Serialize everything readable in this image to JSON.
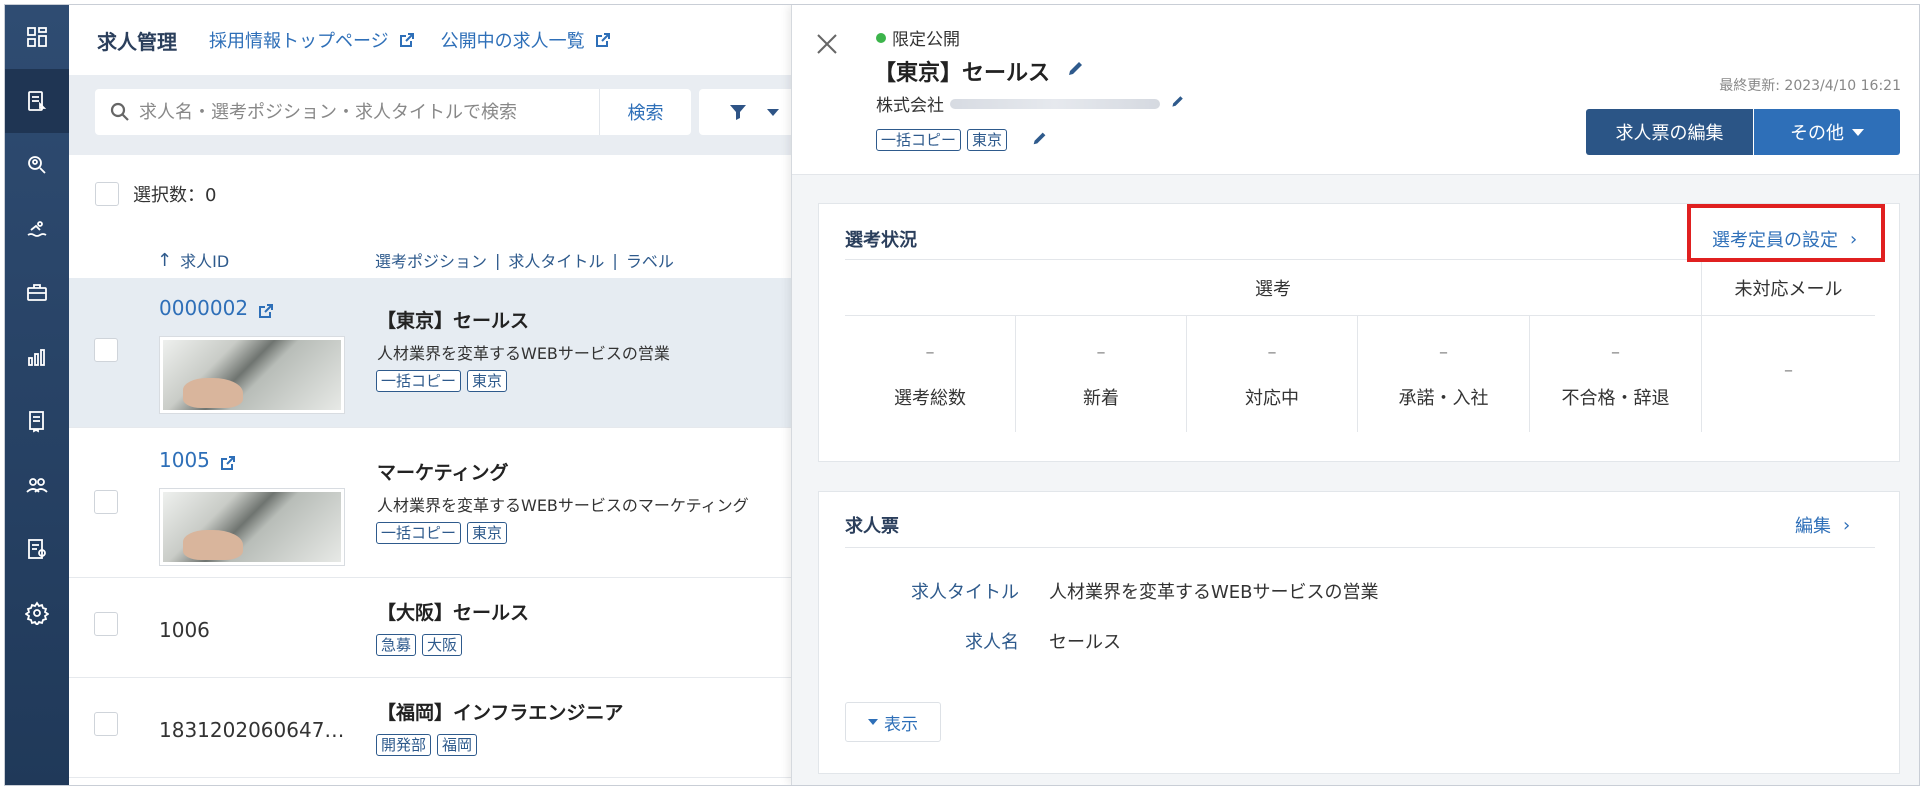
{
  "sidebar": {
    "icons": [
      "dashboard-icon",
      "job-list-icon",
      "candidate-search-icon",
      "swim-icon",
      "briefcase-icon",
      "bar-chart-icon",
      "document-icon",
      "users-icon",
      "report-icon",
      "settings-icon"
    ]
  },
  "list": {
    "title": "求人管理",
    "links": [
      "採用情報トップページ",
      "公開中の求人一覧"
    ],
    "search": {
      "placeholder": "求人名・選考ポジション・求人タイトルで検索",
      "button": "検索"
    },
    "selection": "選択数：0",
    "columns": {
      "id": "求人ID",
      "position": "選考ポジション",
      "job_title": "求人タイトル",
      "label": "ラベル"
    },
    "rows": [
      {
        "id": "0000002",
        "title": "【東京】セールス",
        "subtitle": "人材業界を変革するWEBサービスの営業",
        "tags": [
          "一括コピー",
          "東京"
        ]
      },
      {
        "id": "1005",
        "title": "マーケティング",
        "subtitle": "人材業界を変革するWEBサービスのマーケティング",
        "tags": [
          "一括コピー",
          "東京"
        ]
      },
      {
        "id": "1006",
        "title": "【大阪】セールス",
        "subtitle": "",
        "tags": [
          "急募",
          "大阪"
        ]
      },
      {
        "id": "1831202060647…",
        "title": "【福岡】インフラエンジニア",
        "subtitle": "",
        "tags": [
          "開発部",
          "福岡"
        ]
      }
    ]
  },
  "detail": {
    "status": "限定公開",
    "title": "【東京】セールス",
    "company": "株式会社",
    "tags": [
      "一括コピー",
      "東京"
    ],
    "updated": "最終更新: 2023/4/10 16:21",
    "edit_button": "求人票の編集",
    "other_button": "その他",
    "selection_card": {
      "title": "選考状況",
      "link": "選考定員の設定",
      "group_header": "選考",
      "mail_header": "未対応メール",
      "cells": [
        {
          "value": "–",
          "label": "選考総数"
        },
        {
          "value": "–",
          "label": "新着"
        },
        {
          "value": "–",
          "label": "対応中"
        },
        {
          "value": "–",
          "label": "承諾・入社"
        },
        {
          "value": "–",
          "label": "不合格・辞退"
        }
      ],
      "mail_value": "–"
    },
    "job_card": {
      "title": "求人票",
      "link": "編集",
      "fields": [
        {
          "label": "求人タイトル",
          "value": "人材業界を変革するWEBサービスの営業"
        },
        {
          "label": "求人名",
          "value": "セールス"
        }
      ],
      "show_button": "表示"
    }
  },
  "colors": {
    "sidebar": "#2f4c72",
    "accent": "#2e6fb8",
    "primary_button": "#2b5586",
    "highlight": "#e02020",
    "status_dot": "#3cb44b"
  }
}
